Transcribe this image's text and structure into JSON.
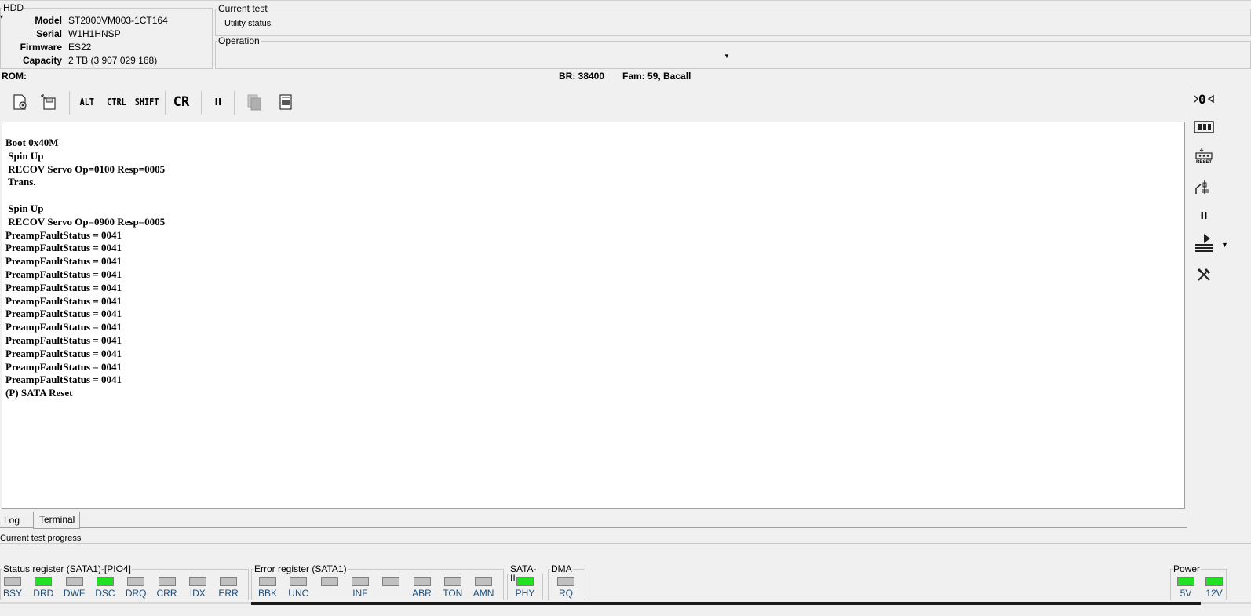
{
  "hdd": {
    "legend": "HDD",
    "rows": [
      {
        "label": "Model",
        "value": "ST2000VM003-1CT164"
      },
      {
        "label": "Serial",
        "value": "W1H1HNSP"
      },
      {
        "label": "Firmware",
        "value": "ES22"
      },
      {
        "label": "Capacity",
        "value": "2 TB (3 907 029 168)"
      }
    ]
  },
  "current_test": {
    "legend": "Current test",
    "value": "Utility status"
  },
  "operation": {
    "legend": "Operation",
    "value": ""
  },
  "info_bar": {
    "rom": "ROM:",
    "br": "BR: 38400",
    "fam": "Fam: 59, Bacall"
  },
  "toolbar": {
    "alt": "ALT",
    "ctrl": "CTRL",
    "shift": "SHIFT",
    "cr": "CR",
    "pause": "II"
  },
  "terminal": {
    "lines": [
      "Boot 0x40M",
      " Spin Up",
      " RECOV Servo Op=0100 Resp=0005",
      " Trans.",
      "",
      " Spin Up",
      " RECOV Servo Op=0900 Resp=0005",
      "PreampFaultStatus = 0041",
      "PreampFaultStatus = 0041",
      "PreampFaultStatus = 0041",
      "PreampFaultStatus = 0041",
      "PreampFaultStatus = 0041",
      "PreampFaultStatus = 0041",
      "PreampFaultStatus = 0041",
      "PreampFaultStatus = 0041",
      "PreampFaultStatus = 0041",
      "PreampFaultStatus = 0041",
      "PreampFaultStatus = 0041",
      "PreampFaultStatus = 0041",
      "(P) SATA Reset"
    ]
  },
  "right_toolbar": {
    "reset_label": "RESET",
    "pause": "II"
  },
  "tabs": {
    "log": "Log",
    "terminal": "Terminal"
  },
  "progress": {
    "label": "Current test progress",
    "value": 0
  },
  "status_register": {
    "legend": "Status register (SATA1)-[PIO4]",
    "leds": [
      {
        "name": "BSY",
        "on": false
      },
      {
        "name": "DRD",
        "on": true
      },
      {
        "name": "DWF",
        "on": false
      },
      {
        "name": "DSC",
        "on": true
      },
      {
        "name": "DRQ",
        "on": false
      },
      {
        "name": "CRR",
        "on": false
      },
      {
        "name": "IDX",
        "on": false
      },
      {
        "name": "ERR",
        "on": false
      }
    ]
  },
  "error_register": {
    "legend": "Error register (SATA1)",
    "leds": [
      {
        "name": "BBK",
        "on": false
      },
      {
        "name": "UNC",
        "on": false
      },
      {
        "name": "",
        "on": false
      },
      {
        "name": "INF",
        "on": false
      },
      {
        "name": "",
        "on": false
      },
      {
        "name": "ABR",
        "on": false
      },
      {
        "name": "TON",
        "on": false
      },
      {
        "name": "AMN",
        "on": false
      }
    ]
  },
  "sata2": {
    "legend": "SATA-II",
    "leds": [
      {
        "name": "PHY",
        "on": true
      }
    ]
  },
  "dma": {
    "legend": "DMA",
    "leds": [
      {
        "name": "RQ",
        "on": false
      }
    ]
  },
  "power": {
    "legend": "Power",
    "leds": [
      {
        "name": "5V",
        "on": true
      },
      {
        "name": "12V",
        "on": true
      }
    ]
  },
  "colors": {
    "led_on": "#22e022",
    "led_off": "#c0c0c0",
    "led_label": "#1f4e79"
  }
}
